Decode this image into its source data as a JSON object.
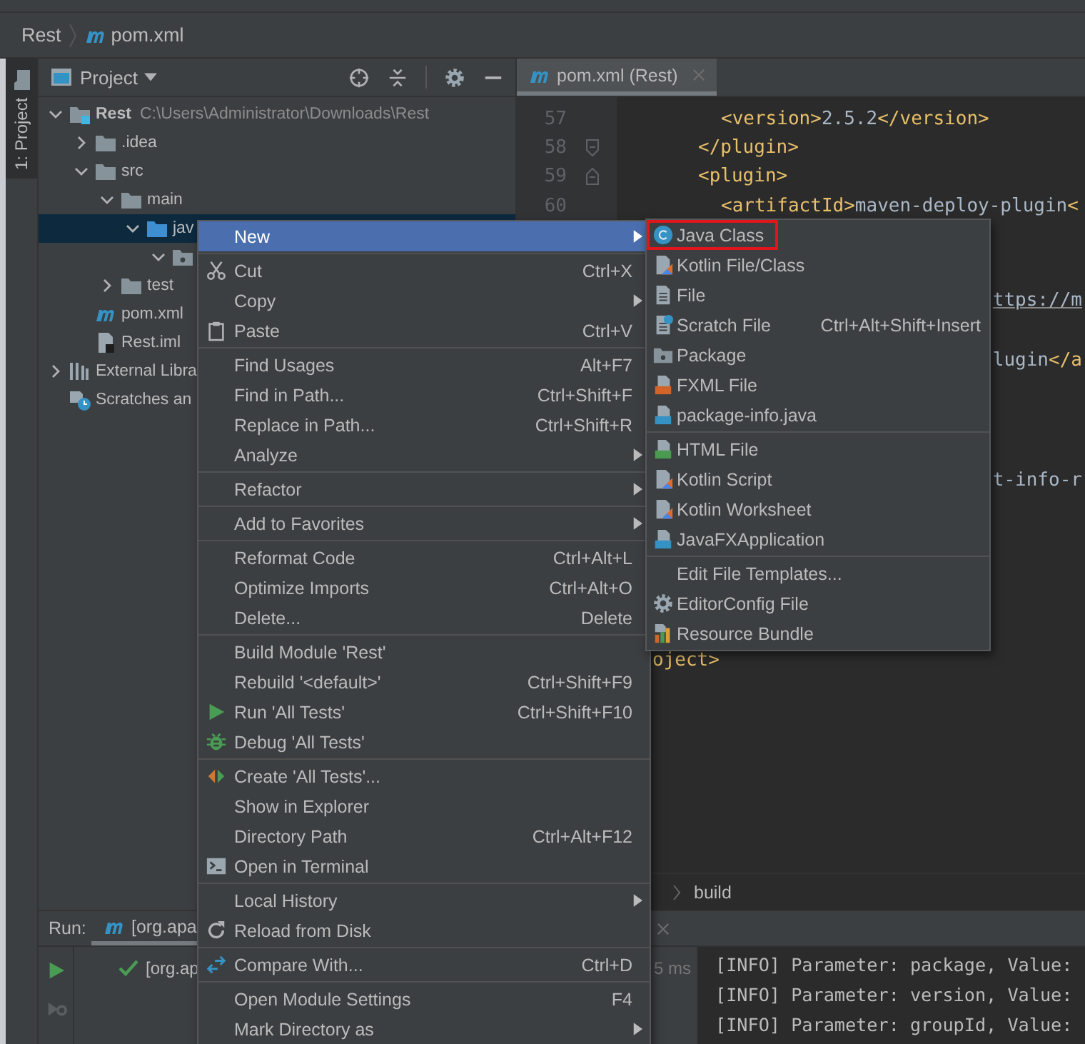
{
  "navigation_bar": {
    "items": [
      {
        "label": "Rest",
        "kind": "project"
      },
      {
        "label": "pom.xml",
        "kind": "maven"
      }
    ]
  },
  "side_tab": {
    "label": "1: Project",
    "selected": true
  },
  "project_panel": {
    "title": "Project",
    "tree": [
      {
        "label": "Rest",
        "path": "C:\\Users\\Administrator\\Downloads\\Rest",
        "kind": "module",
        "expanded": true,
        "selected": false,
        "children": [
          {
            "label": ".idea",
            "kind": "folder",
            "expanded": false,
            "selected": false
          },
          {
            "label": "src",
            "kind": "folder",
            "expanded": true,
            "selected": false,
            "children": [
              {
                "label": "main",
                "kind": "folder",
                "expanded": true,
                "selected": false,
                "children": [
                  {
                    "label": "jav",
                    "kind": "source",
                    "expanded": true,
                    "selected": true,
                    "children": [
                      {
                        "kind": "package",
                        "expanded": true,
                        "selected": false
                      }
                    ]
                  }
                ]
              },
              {
                "label": "test",
                "kind": "folder",
                "expanded": false,
                "selected": false
              }
            ]
          },
          {
            "label": "pom.xml",
            "kind": "maven",
            "selected": false
          },
          {
            "label": "Rest.iml",
            "kind": "iml",
            "selected": false
          }
        ]
      },
      {
        "label": "External Libra",
        "kind": "library",
        "expanded": false,
        "selected": false
      },
      {
        "label": "Scratches an",
        "kind": "scratches",
        "selected": false
      }
    ]
  },
  "editor": {
    "tabs": [
      {
        "label": "pom.xml (Rest)",
        "selected": true
      }
    ],
    "lines": [
      {
        "number": "57",
        "text": "<version>2.5.2</version>",
        "kind": "inner"
      },
      {
        "number": "58",
        "text": "</plugin>",
        "kind": "outer_fold_end"
      },
      {
        "number": "59",
        "text": "<plugin>",
        "kind": "outer_fold_start"
      },
      {
        "number": "60",
        "text": "<artifactId>maven-deploy-plugin<",
        "kind": "inner"
      }
    ],
    "fragments": [
      {
        "text": "ttps://m",
        "kind": "link"
      },
      {
        "text": "lugin</a",
        "kind": "code"
      },
      {
        "text": "t-info-r",
        "kind": "code"
      },
      {
        "text": "oject>",
        "kind": "tag"
      }
    ],
    "breadcrumb": [
      {
        "label": "build"
      }
    ]
  },
  "run_panel": {
    "label": "Run:",
    "tabs": [
      {
        "label": "[org.apa",
        "selected": true
      }
    ],
    "tests": [
      {
        "label": "[org.ap",
        "passed": true,
        "time": "5 ms"
      }
    ],
    "console": [
      "[INFO] Parameter: package, Value:",
      "[INFO] Parameter: version, Value:",
      "[INFO] Parameter: groupId, Value:"
    ]
  },
  "context_menu": {
    "groups": [
      [
        {
          "label": "New",
          "kind": "plain",
          "submenu": true,
          "selected": true
        }
      ],
      [
        {
          "label": "Cut",
          "kind": "cut",
          "shortcut": "Ctrl+X",
          "selected": false
        },
        {
          "label": "Copy",
          "kind": "plain",
          "submenu": true,
          "selected": false
        },
        {
          "label": "Paste",
          "kind": "paste",
          "shortcut": "Ctrl+V",
          "selected": false
        }
      ],
      [
        {
          "label": "Find Usages",
          "kind": "plain",
          "shortcut": "Alt+F7",
          "selected": false
        },
        {
          "label": "Find in Path...",
          "kind": "plain",
          "shortcut": "Ctrl+Shift+F",
          "selected": false
        },
        {
          "label": "Replace in Path...",
          "kind": "plain",
          "shortcut": "Ctrl+Shift+R",
          "selected": false
        },
        {
          "label": "Analyze",
          "kind": "plain",
          "submenu": true,
          "selected": false
        }
      ],
      [
        {
          "label": "Refactor",
          "kind": "plain",
          "submenu": true,
          "selected": false
        }
      ],
      [
        {
          "label": "Add to Favorites",
          "kind": "plain",
          "submenu": true,
          "selected": false
        }
      ],
      [
        {
          "label": "Reformat Code",
          "kind": "plain",
          "shortcut": "Ctrl+Alt+L",
          "selected": false
        },
        {
          "label": "Optimize Imports",
          "kind": "plain",
          "shortcut": "Ctrl+Alt+O",
          "selected": false
        },
        {
          "label": "Delete...",
          "kind": "plain",
          "shortcut": "Delete",
          "selected": false
        }
      ],
      [
        {
          "label": "Build Module 'Rest'",
          "kind": "plain",
          "selected": false
        },
        {
          "label": "Rebuild '<default>'",
          "kind": "plain",
          "shortcut": "Ctrl+Shift+F9",
          "selected": false
        },
        {
          "label": "Run 'All Tests'",
          "kind": "run",
          "shortcut": "Ctrl+Shift+F10",
          "selected": false
        },
        {
          "label": "Debug 'All Tests'",
          "kind": "debug",
          "selected": false
        }
      ],
      [
        {
          "label": "Create 'All Tests'...",
          "kind": "create",
          "selected": false
        },
        {
          "label": "Show in Explorer",
          "kind": "plain",
          "selected": false
        },
        {
          "label": "Directory Path",
          "kind": "plain",
          "shortcut": "Ctrl+Alt+F12",
          "selected": false
        },
        {
          "label": "Open in Terminal",
          "kind": "terminal",
          "selected": false
        }
      ],
      [
        {
          "label": "Local History",
          "kind": "plain",
          "submenu": true,
          "selected": false
        },
        {
          "label": "Reload from Disk",
          "kind": "reload",
          "selected": false
        }
      ],
      [
        {
          "label": "Compare With...",
          "kind": "compare",
          "shortcut": "Ctrl+D",
          "selected": false
        }
      ],
      [
        {
          "label": "Open Module Settings",
          "kind": "plain",
          "shortcut": "F4",
          "selected": false
        },
        {
          "label": "Mark Directory as",
          "kind": "plain",
          "submenu": true,
          "selected": false
        }
      ]
    ]
  },
  "submenu": {
    "groups": [
      [
        {
          "label": "Java Class",
          "kind": "class",
          "outlined": true
        },
        {
          "label": "Kotlin File/Class",
          "kind": "kotlin",
          "outlined": false
        },
        {
          "label": "File",
          "kind": "file",
          "outlined": false
        },
        {
          "label": "Scratch File",
          "kind": "scratch",
          "shortcut": "Ctrl+Alt+Shift+Insert",
          "outlined": false
        },
        {
          "label": "Package",
          "kind": "package",
          "outlined": false
        },
        {
          "label": "FXML File",
          "kind": "fxml",
          "outlined": false
        },
        {
          "label": "package-info.java",
          "kind": "javainfo",
          "outlined": false
        }
      ],
      [
        {
          "label": "HTML File",
          "kind": "html",
          "outlined": false
        },
        {
          "label": "Kotlin Script",
          "kind": "kotlin",
          "outlined": false
        },
        {
          "label": "Kotlin Worksheet",
          "kind": "kotlin",
          "outlined": false
        },
        {
          "label": "JavaFXApplication",
          "kind": "javafx",
          "outlined": false
        }
      ],
      [
        {
          "label": "Edit File Templates...",
          "kind": "plain",
          "outlined": false
        },
        {
          "label": "EditorConfig File",
          "kind": "editorconfig",
          "outlined": false
        },
        {
          "label": "Resource Bundle",
          "kind": "bundle",
          "outlined": false
        }
      ]
    ]
  }
}
